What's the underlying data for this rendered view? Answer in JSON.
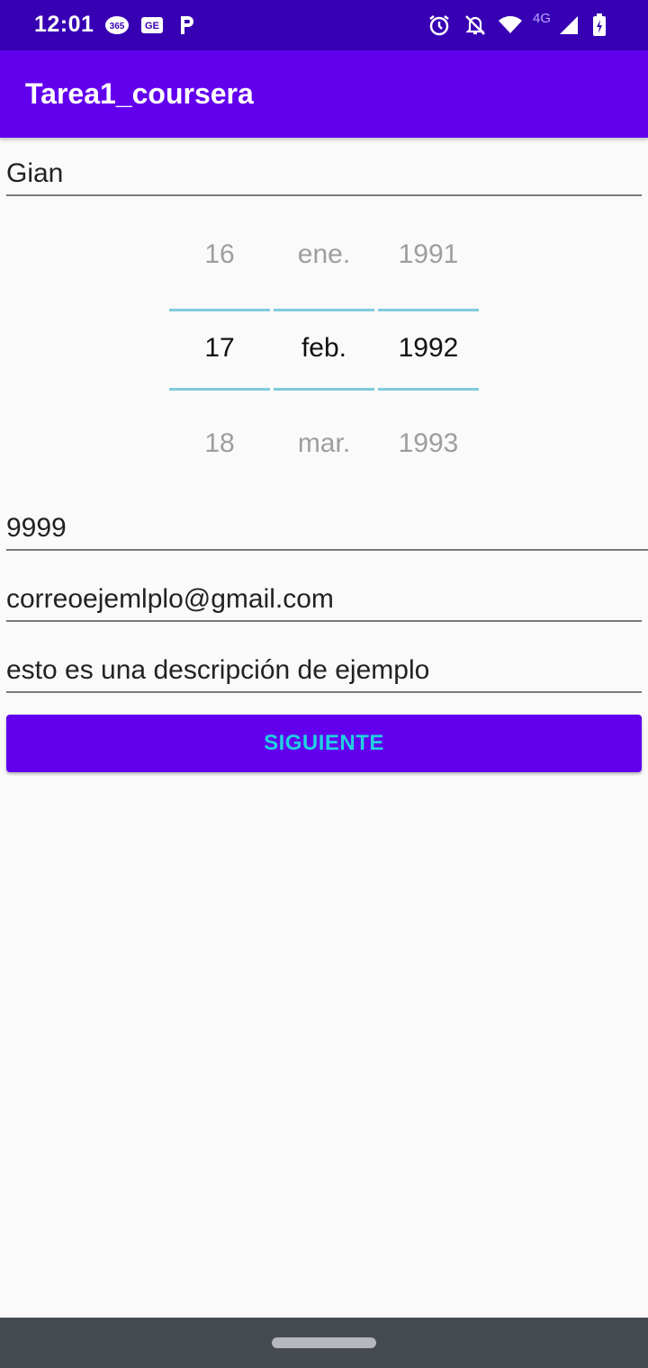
{
  "status_bar": {
    "time": "12:01",
    "network_label": "4G",
    "icons": [
      "365-app-icon",
      "ge-icon",
      "p-app-icon",
      "alarm-icon",
      "notifications-off-icon",
      "wifi-icon",
      "signal-icon",
      "battery-charging-icon"
    ]
  },
  "app_bar": {
    "title": "Tarea1_coursera"
  },
  "form": {
    "name_value": "Gian",
    "phone_value": "9999",
    "email_value": "correoejemlplo@gmail.com",
    "description_value": "esto es una descripción de ejemplo",
    "button_label": "SIGUIENTE"
  },
  "date_picker": {
    "day": {
      "prev": "16",
      "selected": "17",
      "next": "18"
    },
    "month": {
      "prev": "ene.",
      "selected": "feb.",
      "next": "mar."
    },
    "year": {
      "prev": "1991",
      "selected": "1992",
      "next": "1993"
    }
  },
  "colors": {
    "status_bar": "#3700b3",
    "app_bar": "#6200ee",
    "button_bg": "#6200ee",
    "button_text": "#1fd1e0",
    "picker_divider": "#7ecbdc",
    "nav_bar": "#464b52"
  }
}
